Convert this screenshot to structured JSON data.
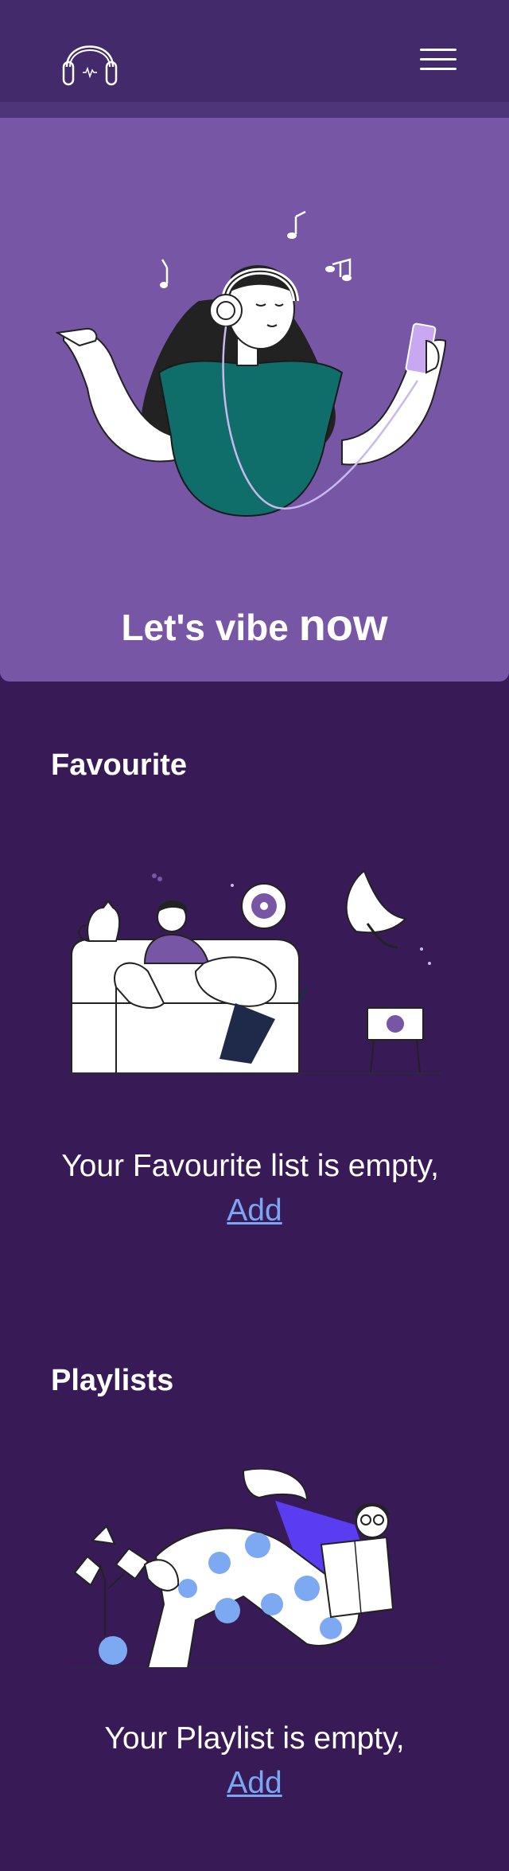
{
  "header": {
    "logo_icon": "headphones-icon",
    "menu_icon": "hamburger-menu-icon"
  },
  "hero": {
    "title_prefix": "Let's vibe ",
    "title_emphasis": "now"
  },
  "favourite": {
    "heading": "Favourite",
    "empty_text": "Your Favourite list is empty,",
    "add_label": "Add"
  },
  "playlists": {
    "heading": "Playlists",
    "empty_text": "Your Playlist is empty,",
    "add_label": "Add"
  },
  "colors": {
    "background": "#381b56",
    "header": "#432a6a",
    "hero": "#7756a6",
    "link": "#7aa6f4",
    "accent_teal": "#0f6d6a",
    "accent_blue": "#7da9f2"
  }
}
